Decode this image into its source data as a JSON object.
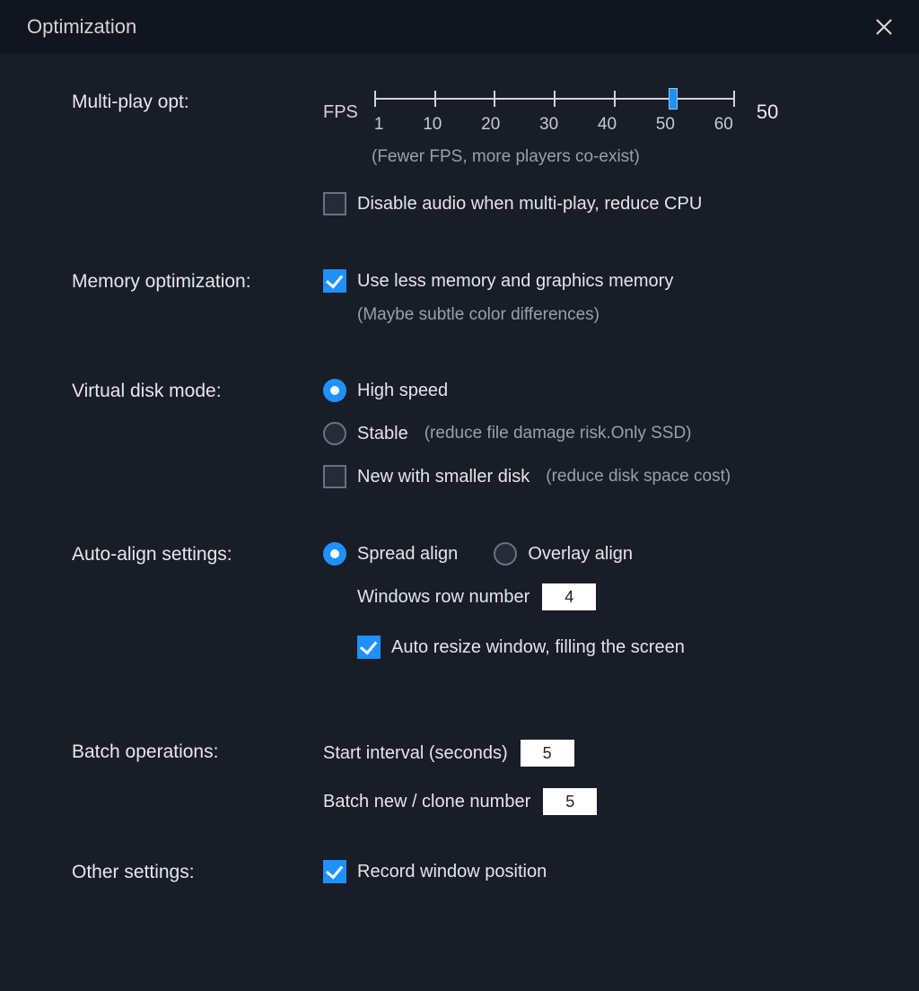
{
  "title": "Optimization",
  "multiPlay": {
    "label": "Multi-play opt:",
    "fpsLabel": "FPS",
    "value": "50",
    "ticks": [
      "1",
      "10",
      "20",
      "30",
      "40",
      "50",
      "60"
    ],
    "hint": "(Fewer FPS, more players co-exist)",
    "disableAudio": "Disable audio when multi-play, reduce CPU"
  },
  "memory": {
    "label": "Memory optimization:",
    "useLess": "Use less memory and graphics memory",
    "hint": "(Maybe subtle color differences)"
  },
  "vdisk": {
    "label": "Virtual disk mode:",
    "highSpeed": "High speed",
    "stable": "Stable",
    "stableHint": "(reduce file damage risk.Only SSD)",
    "newSmaller": "New with smaller disk",
    "newSmallerHint": "(reduce disk space cost)"
  },
  "autoAlign": {
    "label": "Auto-align settings:",
    "spread": "Spread align",
    "overlay": "Overlay align",
    "rowNumLabel": "Windows row number",
    "rowNum": "4",
    "autoResize": "Auto resize window, filling the screen"
  },
  "batch": {
    "label": "Batch operations:",
    "startIntervalLabel": "Start interval (seconds)",
    "startInterval": "5",
    "cloneLabel": "Batch new / clone number",
    "cloneNum": "5"
  },
  "other": {
    "label": "Other settings:",
    "recordPos": "Record window position"
  }
}
